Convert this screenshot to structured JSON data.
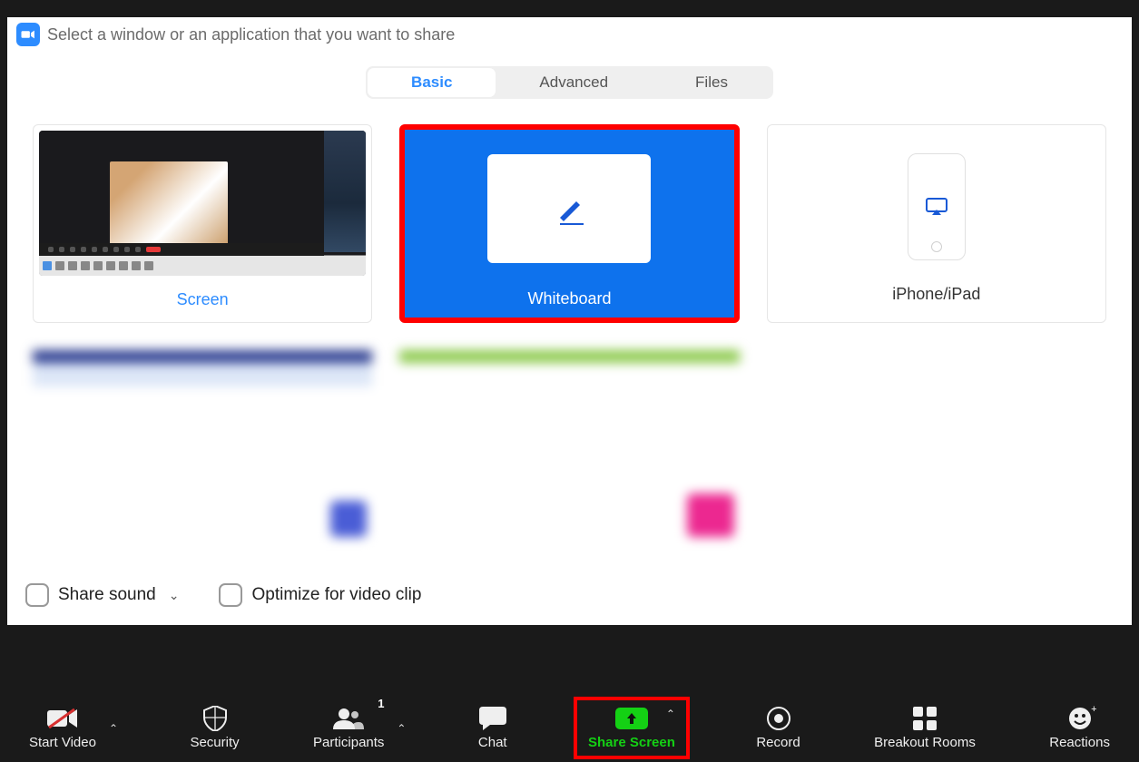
{
  "dialog": {
    "title": "Select a window or an application that you want to share",
    "tabs": {
      "basic": "Basic",
      "advanced": "Advanced",
      "files": "Files"
    },
    "options": {
      "screen": "Screen",
      "whiteboard": "Whiteboard",
      "iphone_ipad": "iPhone/iPad"
    },
    "footer": {
      "share_sound": "Share sound",
      "optimize_video": "Optimize for video clip"
    }
  },
  "toolbar": {
    "start_video": "Start Video",
    "security": "Security",
    "participants": "Participants",
    "participants_count": "1",
    "chat": "Chat",
    "share_screen": "Share Screen",
    "record": "Record",
    "breakout": "Breakout Rooms",
    "reactions": "Reactions"
  }
}
